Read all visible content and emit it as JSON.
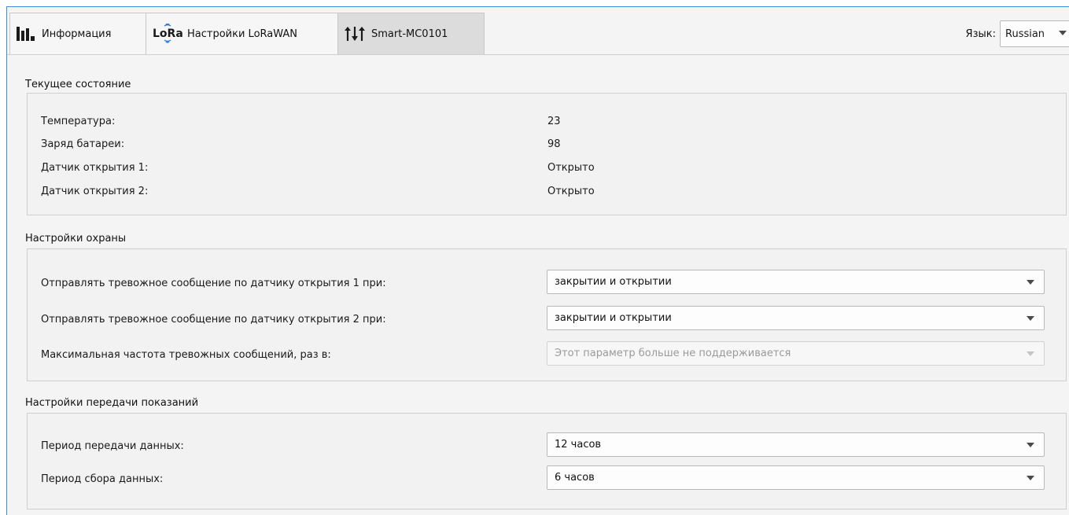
{
  "tabs": [
    {
      "label": "Информация",
      "icon": "bar-chart-icon"
    },
    {
      "label": "Настройки LoRaWAN",
      "icon": "lora-logo-icon",
      "logo_text": "LoRa"
    },
    {
      "label": "Smart-MC0101",
      "icon": "sliders-icon",
      "active": true
    }
  ],
  "language": {
    "label": "Язык:",
    "value": "Russian"
  },
  "status": {
    "title": "Текущее состояние",
    "rows": [
      {
        "label": "Температура:",
        "value": "23"
      },
      {
        "label": "Заряд батареи:",
        "value": "98"
      },
      {
        "label": "Датчик открытия 1:",
        "value": "Открыто"
      },
      {
        "label": "Датчик открытия 2:",
        "value": "Открыто"
      }
    ]
  },
  "security": {
    "title": "Настройки охраны",
    "fields": [
      {
        "label": "Отправлять тревожное сообщение по датчику открытия 1 при:",
        "value": "закрытии и открытии",
        "disabled": false
      },
      {
        "label": "Отправлять тревожное сообщение по датчику открытия 2 при:",
        "value": "закрытии и открытии",
        "disabled": false
      },
      {
        "label": "Максимальная частота тревожных сообщений, раз в:",
        "value": "Этот параметр больше не поддерживается",
        "disabled": true
      }
    ]
  },
  "transmission": {
    "title": "Настройки передачи показаний",
    "fields": [
      {
        "label": "Период передачи данных:",
        "value": "12 часов"
      },
      {
        "label": "Период сбора данных:",
        "value": "6 часов"
      }
    ]
  },
  "colors": {
    "accent": "#3c8fd6",
    "active_tab": "#dcdcdc",
    "panel": "#f2f2f2"
  }
}
